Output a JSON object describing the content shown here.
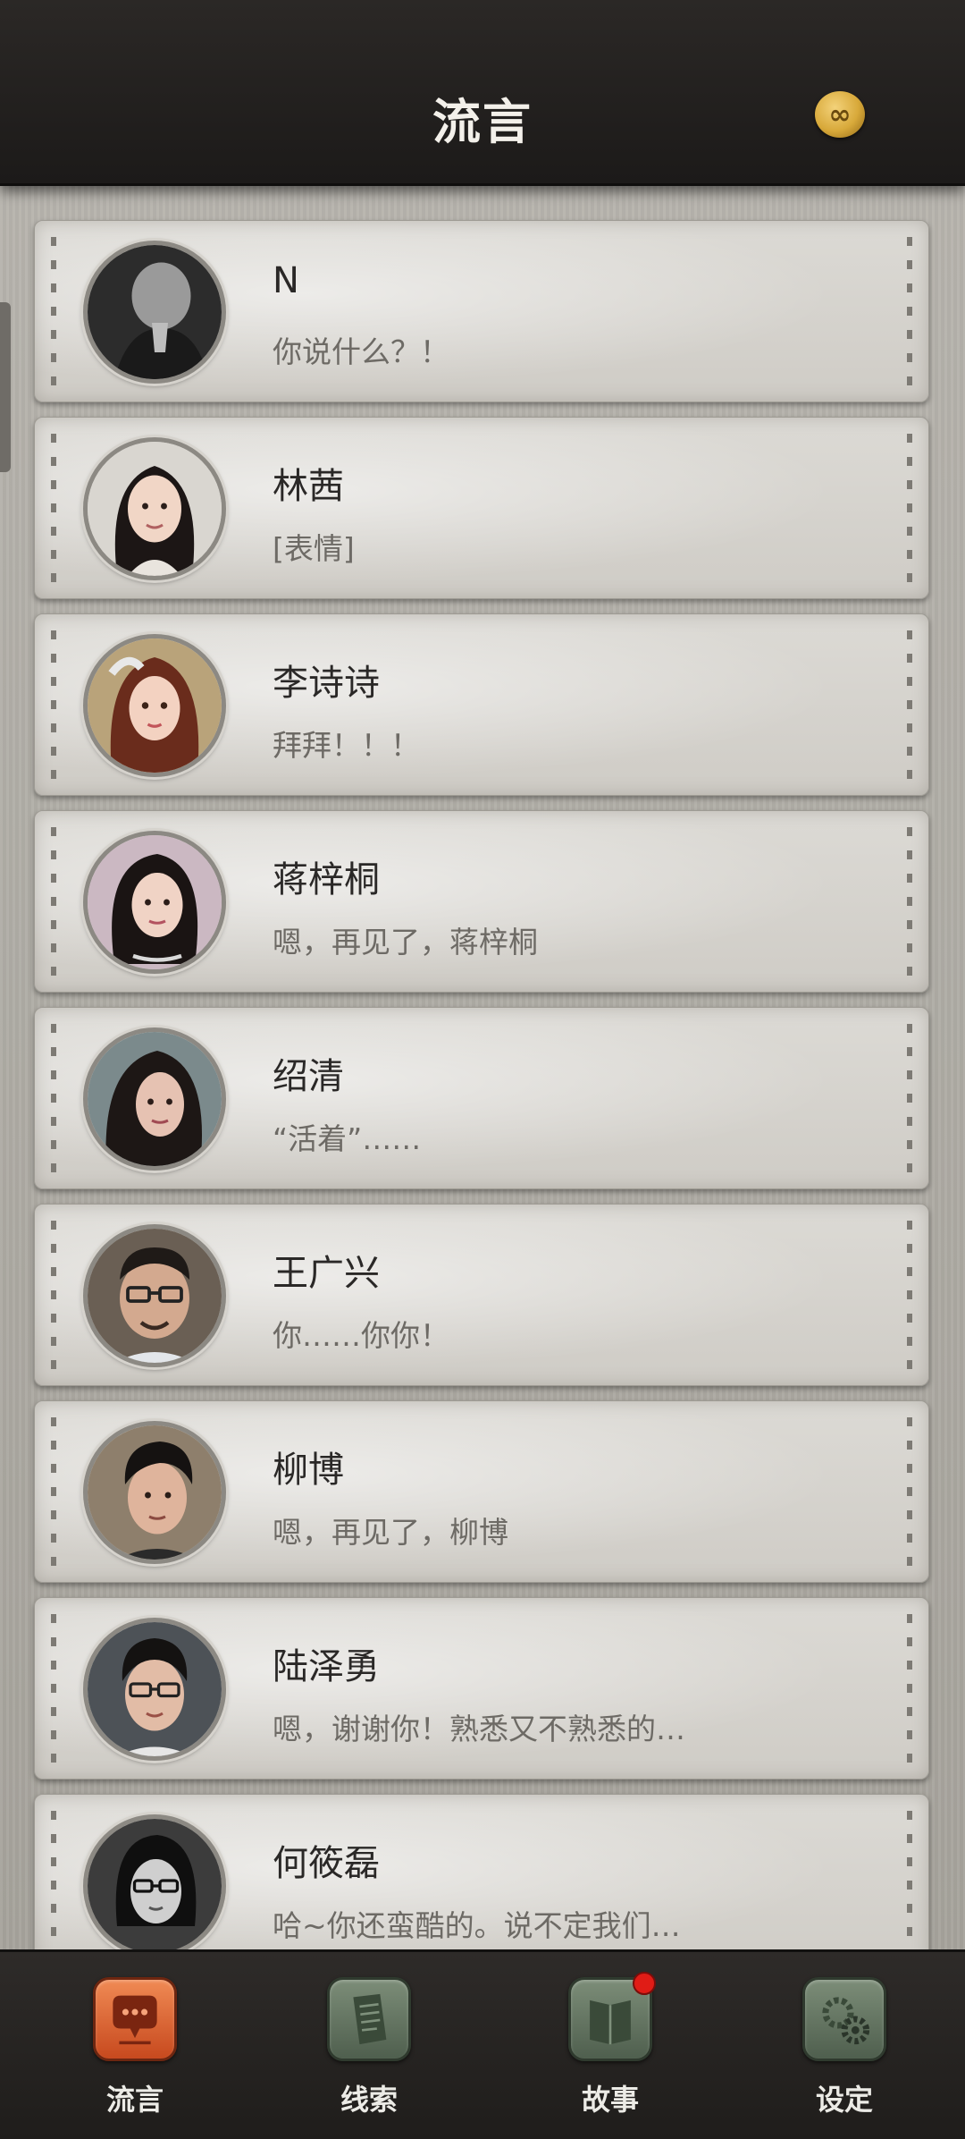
{
  "header": {
    "title": "流言",
    "coin_icon": "infinity-coin-icon",
    "coin_glyph": "∞"
  },
  "contacts": [
    {
      "name": "N",
      "message": "你说什么？！",
      "avatar_icon": "avatar-n"
    },
    {
      "name": "林茜",
      "message": "[表情]",
      "avatar_icon": "avatar-linqian"
    },
    {
      "name": "李诗诗",
      "message": "拜拜！！！",
      "avatar_icon": "avatar-lishishi"
    },
    {
      "name": "蒋梓桐",
      "message": "嗯，再见了，蒋梓桐",
      "avatar_icon": "avatar-jiangzitong"
    },
    {
      "name": "绍清",
      "message": "“活着”……",
      "avatar_icon": "avatar-shaoqing"
    },
    {
      "name": "王广兴",
      "message": "你……你你！",
      "avatar_icon": "avatar-wangguangxing"
    },
    {
      "name": "柳博",
      "message": "嗯，再见了，柳博",
      "avatar_icon": "avatar-liubo"
    },
    {
      "name": "陆泽勇",
      "message": "嗯，谢谢你！熟悉又不熟悉的…",
      "avatar_icon": "avatar-luzeyong"
    },
    {
      "name": "何筱磊",
      "message": "哈~你还蛮酷的。说不定我们…",
      "avatar_icon": "avatar-hexiaolei"
    }
  ],
  "nav": [
    {
      "label": "流言",
      "icon": "chat-bubble-icon",
      "active": true
    },
    {
      "label": "线索",
      "icon": "document-icon",
      "active": false
    },
    {
      "label": "故事",
      "icon": "book-icon",
      "active": false,
      "badge": true
    },
    {
      "label": "设定",
      "icon": "gear-icon",
      "active": false
    }
  ],
  "colors": {
    "active_tab": "#e0642f",
    "tab": "#61725f",
    "badge": "#e01c16"
  }
}
